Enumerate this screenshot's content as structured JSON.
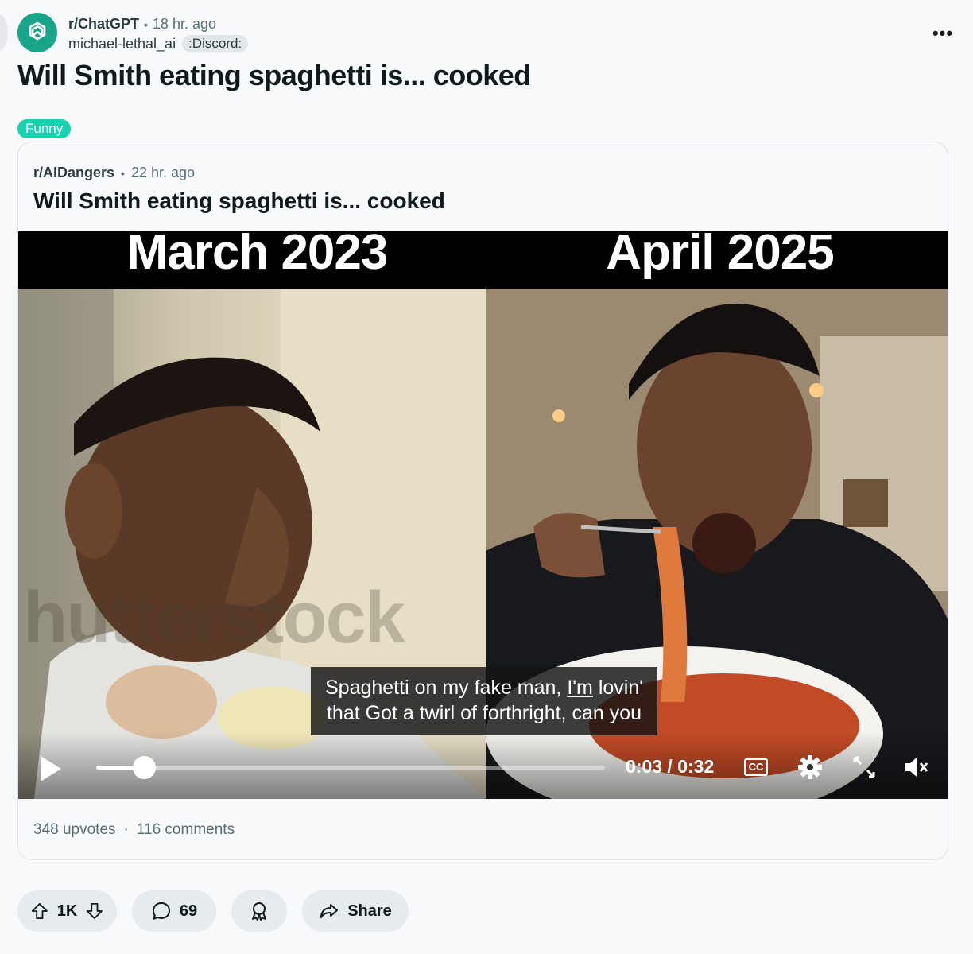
{
  "post": {
    "subreddit": "r/ChatGPT",
    "time": "18 hr. ago",
    "author": "michael-lethal_ai",
    "user_flair": ":Discord:",
    "more_label": "•••",
    "title": "Will Smith eating spaghetti is... cooked",
    "flair": "Funny"
  },
  "crosspost": {
    "subreddit": "r/AIDangers",
    "time": "22 hr. ago",
    "title": "Will Smith eating spaghetti is... cooked",
    "upvotes": "348 upvotes",
    "comments": "116 comments"
  },
  "video": {
    "left_label": "March 2023",
    "right_label": "April 2025",
    "caption_line1_a": "Spaghetti on my fake man, ",
    "caption_line1_underlined": "I'm",
    "caption_line1_b": " lovin'",
    "caption_line2": "that Got a twirl of forthright, can you",
    "watermark": "hutterstock",
    "time_readout": "0:03 / 0:32",
    "progress_fraction": 0.094,
    "cc_label": "CC"
  },
  "actions": {
    "votes": "1K",
    "comments": "69",
    "share": "Share"
  },
  "colors": {
    "accent_flair": "#19d2b0",
    "avatar": "#19a58a",
    "background": "#f8f9fb",
    "pill": "#e5ebee"
  }
}
